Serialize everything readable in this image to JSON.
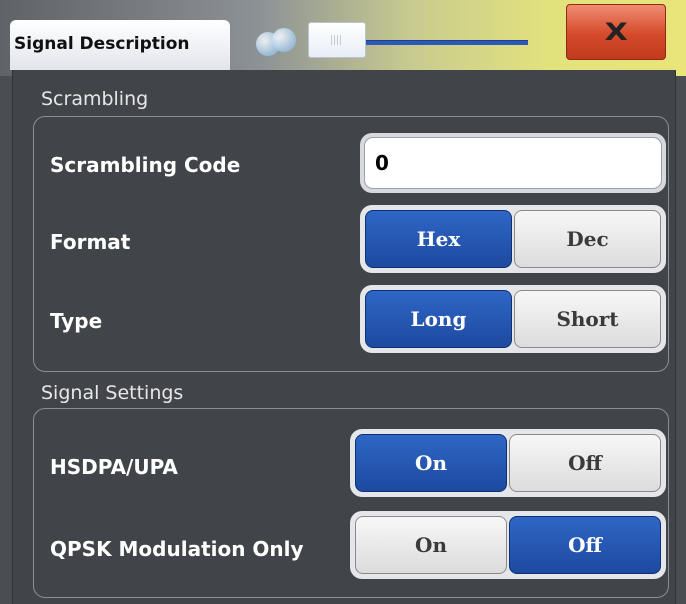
{
  "dialog": {
    "title": "Signal Description",
    "close_label": "X"
  },
  "scrambling": {
    "section_label": "Scrambling",
    "code": {
      "label": "Scrambling Code",
      "value": "0"
    },
    "format": {
      "label": "Format",
      "options": [
        "Hex",
        "Dec"
      ],
      "selected": "Hex"
    },
    "type": {
      "label": "Type",
      "options": [
        "Long",
        "Short"
      ],
      "selected": "Long"
    }
  },
  "signal_settings": {
    "section_label": "Signal Settings",
    "hsdpa": {
      "label": "HSDPA/UPA",
      "options": [
        "On",
        "Off"
      ],
      "selected": "On"
    },
    "qpsk": {
      "label": "QPSK Modulation Only",
      "options": [
        "On",
        "Off"
      ],
      "selected": "Off"
    }
  },
  "colors": {
    "selected_segment": "#2f66c6",
    "close_button": "#d44a2a",
    "panel_background": "#414549"
  }
}
